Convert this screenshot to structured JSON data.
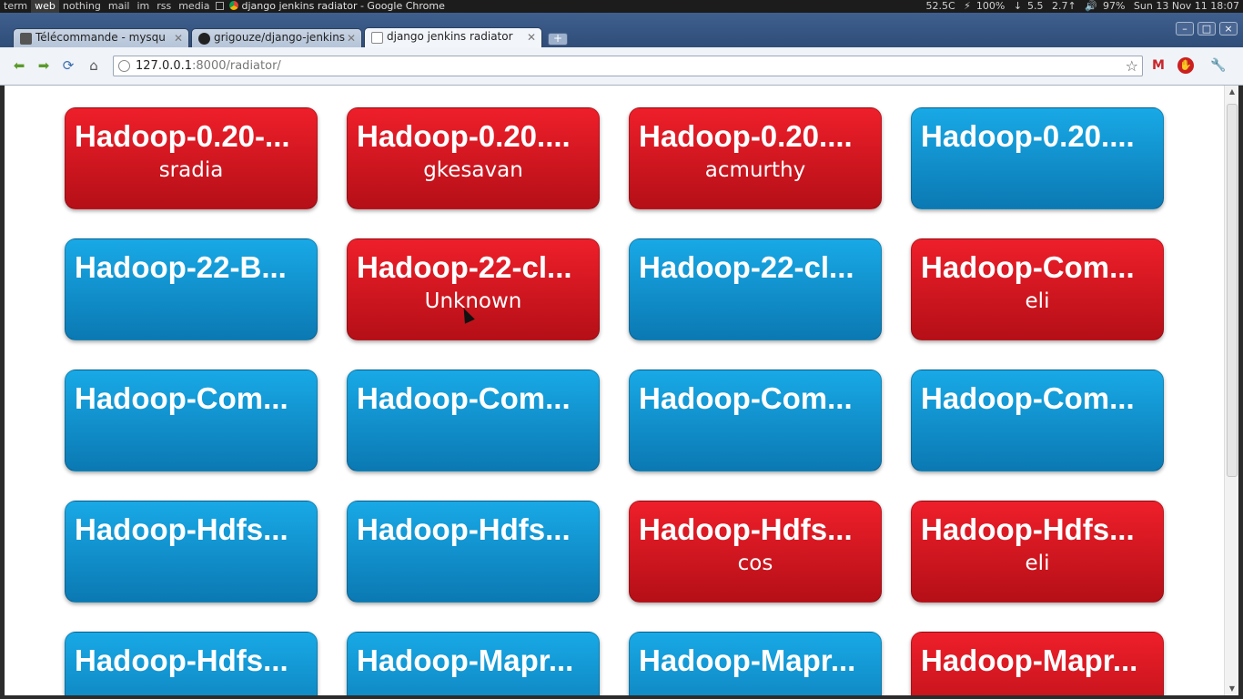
{
  "panel": {
    "workspaces": [
      "term",
      "web",
      "nothing",
      "mail",
      "im",
      "rss",
      "media"
    ],
    "active_workspace": "web",
    "window_title": "django jenkins radiator - Google Chrome",
    "temperature": "52.5C",
    "battery": "100%",
    "net_down": "5.5",
    "net_up": "2.7",
    "volume": "97%",
    "datetime": "Sun 13 Nov 11 18:07"
  },
  "browser": {
    "tabs": [
      {
        "label": "Télécommande - mysqu",
        "favicon_color": "#555555"
      },
      {
        "label": "grigouze/django-jenkins",
        "favicon_color": "#222222"
      },
      {
        "label": "django jenkins radiator",
        "favicon_color": "#ffffff",
        "active": true
      }
    ],
    "new_tab": "+",
    "url_host": "127.0.0.1",
    "url_path": ":8000/radiator/",
    "window_buttons": [
      "–",
      "□",
      "×"
    ]
  },
  "jobs": [
    {
      "name": "Hadoop-0.20-...",
      "culprit": "sradia",
      "status": "red"
    },
    {
      "name": "Hadoop-0.20....",
      "culprit": "gkesavan",
      "status": "red"
    },
    {
      "name": "Hadoop-0.20....",
      "culprit": "acmurthy",
      "status": "red"
    },
    {
      "name": "Hadoop-0.20....",
      "culprit": "",
      "status": "blue"
    },
    {
      "name": "Hadoop-22-B...",
      "culprit": "",
      "status": "blue"
    },
    {
      "name": "Hadoop-22-cl...",
      "culprit": "Unknown",
      "status": "red"
    },
    {
      "name": "Hadoop-22-cl...",
      "culprit": "",
      "status": "blue"
    },
    {
      "name": "Hadoop-Com...",
      "culprit": "eli",
      "status": "red"
    },
    {
      "name": "Hadoop-Com...",
      "culprit": "",
      "status": "blue"
    },
    {
      "name": "Hadoop-Com...",
      "culprit": "",
      "status": "blue"
    },
    {
      "name": "Hadoop-Com...",
      "culprit": "",
      "status": "blue"
    },
    {
      "name": "Hadoop-Com...",
      "culprit": "",
      "status": "blue"
    },
    {
      "name": "Hadoop-Hdfs...",
      "culprit": "",
      "status": "blue"
    },
    {
      "name": "Hadoop-Hdfs...",
      "culprit": "",
      "status": "blue"
    },
    {
      "name": "Hadoop-Hdfs...",
      "culprit": "cos",
      "status": "red"
    },
    {
      "name": "Hadoop-Hdfs...",
      "culprit": "eli",
      "status": "red"
    },
    {
      "name": "Hadoop-Hdfs...",
      "culprit": "",
      "status": "blue"
    },
    {
      "name": "Hadoop-Mapr...",
      "culprit": "",
      "status": "blue"
    },
    {
      "name": "Hadoop-Mapr...",
      "culprit": "",
      "status": "blue"
    },
    {
      "name": "Hadoop-Mapr...",
      "culprit": "",
      "status": "red"
    }
  ]
}
